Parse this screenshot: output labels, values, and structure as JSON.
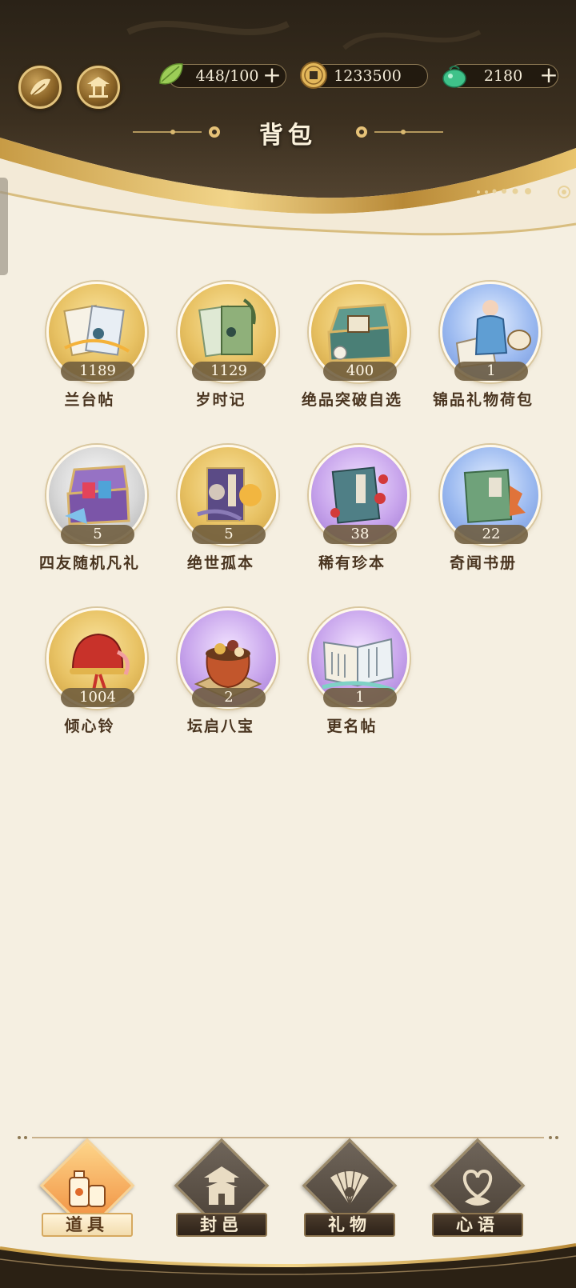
{
  "header": {
    "title": "背包",
    "resources": [
      {
        "icon": "leaf-stamina-icon",
        "value": "448/100",
        "has_plus": true
      },
      {
        "icon": "copper-coin-icon",
        "value": "1233500",
        "has_plus": false
      },
      {
        "icon": "jade-pouch-icon",
        "value": "2180",
        "has_plus": true
      }
    ]
  },
  "items": [
    {
      "name": "兰台帖",
      "count": "1189",
      "frame": "gold",
      "icon": "letter-envelope-icon"
    },
    {
      "name": "岁时记",
      "count": "1129",
      "frame": "gold",
      "icon": "green-book-icon"
    },
    {
      "name": "绝品突破自选",
      "count": "400",
      "frame": "gold",
      "icon": "treasure-chest-icon"
    },
    {
      "name": "锦品礼物荷包",
      "count": "1",
      "frame": "blue",
      "icon": "gift-pouch-icon"
    },
    {
      "name": "四友随机凡礼",
      "count": "5",
      "frame": "silver",
      "icon": "gift-box-icon"
    },
    {
      "name": "绝世孤本",
      "count": "5",
      "frame": "gold",
      "icon": "rare-book-icon"
    },
    {
      "name": "稀有珍本",
      "count": "38",
      "frame": "purple",
      "icon": "flower-book-icon"
    },
    {
      "name": "奇闻书册",
      "count": "22",
      "frame": "blue",
      "icon": "maple-book-icon"
    },
    {
      "name": "倾心铃",
      "count": "1004",
      "frame": "gold",
      "icon": "red-bell-icon"
    },
    {
      "name": "坛启八宝",
      "count": "2",
      "frame": "purple",
      "icon": "clay-pot-icon"
    },
    {
      "name": "更名帖",
      "count": "1",
      "frame": "purple",
      "icon": "open-book-icon"
    }
  ],
  "nav": [
    {
      "label": "道具",
      "icon": "potion-bottles-icon",
      "active": true
    },
    {
      "label": "封邑",
      "icon": "pagoda-icon",
      "active": false
    },
    {
      "label": "礼物",
      "icon": "folding-fan-icon",
      "active": false
    },
    {
      "label": "心语",
      "icon": "heart-knot-icon",
      "active": false
    }
  ],
  "colors": {
    "accent_gold": "#d6a960",
    "header_dark": "#2b2114",
    "background": "#f5efe1"
  }
}
